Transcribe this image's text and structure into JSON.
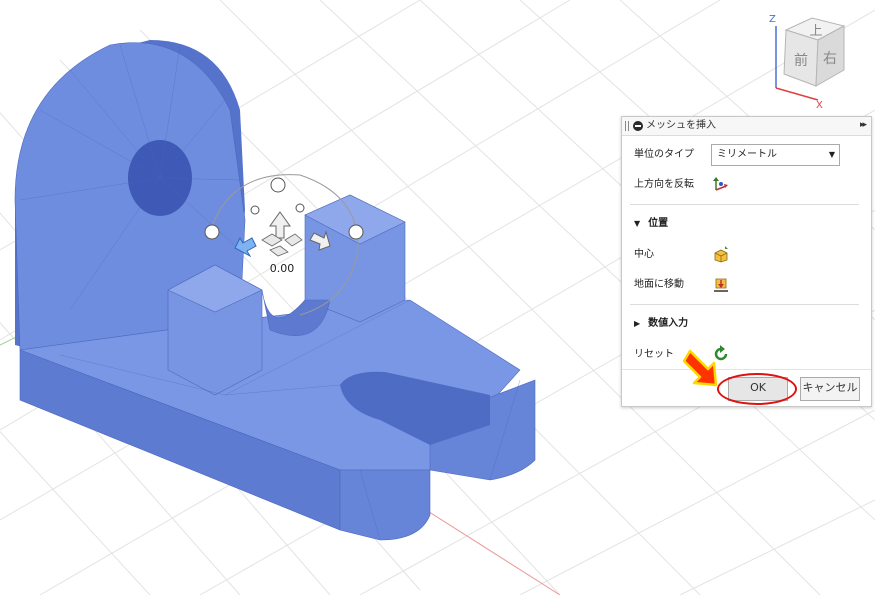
{
  "viewcube": {
    "axis_z": "Z",
    "axis_x": "X",
    "top": "上",
    "front": "前",
    "right": "右"
  },
  "gizmo": {
    "value": "0.00"
  },
  "dialog": {
    "title": "メッシュを挿入",
    "expand_glyph": "▸▸",
    "unit_type_label": "単位のタイプ",
    "unit_type_value": "ミリメートル",
    "flip_up_label": "上方向を反転",
    "position_section": "位置",
    "center_label": "中心",
    "move_to_ground_label": "地面に移動",
    "numeric_input_section": "数値入力",
    "reset_label": "リセット",
    "ok_label": "OK",
    "cancel_label": "キャンセル"
  },
  "colors": {
    "model": "#6f8ddf",
    "model_dark": "#5573cb",
    "annotation": "#e01010",
    "arrow_fill": "#ff3300",
    "arrow_stroke": "#ffd800"
  }
}
